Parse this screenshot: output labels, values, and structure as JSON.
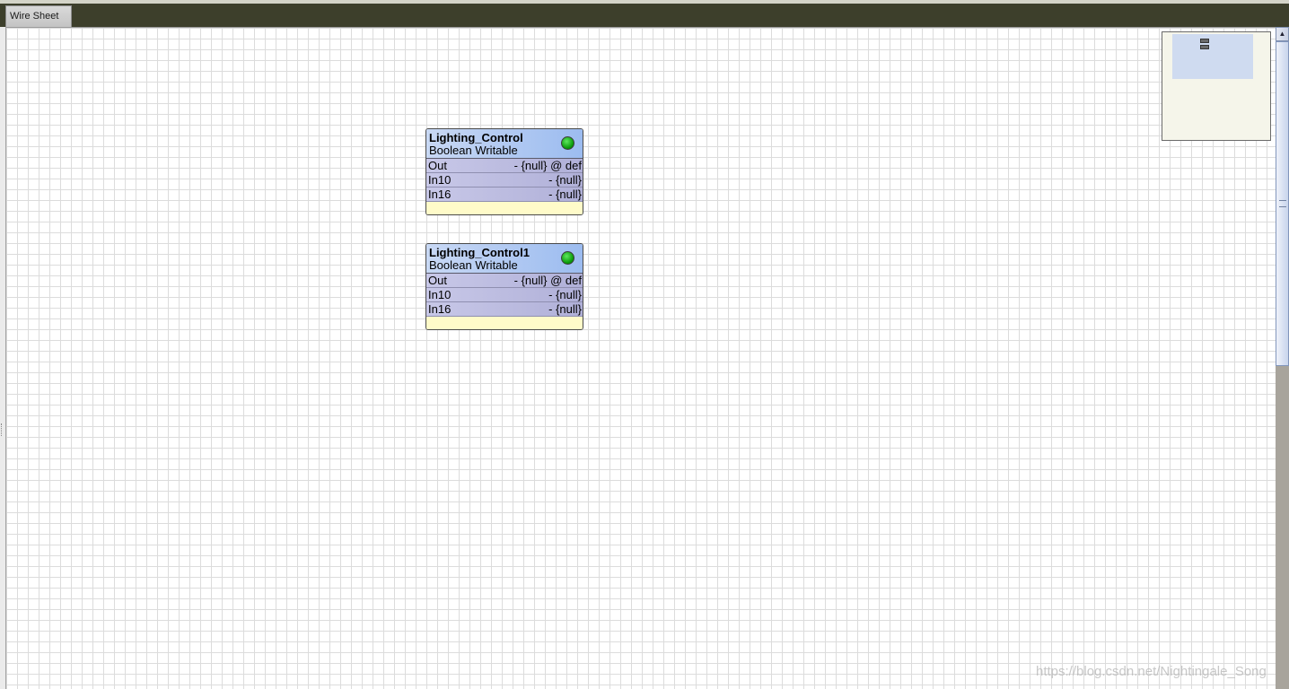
{
  "tabs": [
    {
      "label": "Wire Sheet"
    }
  ],
  "nodes": [
    {
      "title": "Lighting_Control",
      "type": "Boolean Writable",
      "status_color": "#16a016",
      "slots": [
        {
          "name": "Out",
          "value": "- {null} @ def"
        },
        {
          "name": "In10",
          "value": "- {null}"
        },
        {
          "name": "In16",
          "value": "- {null}"
        }
      ]
    },
    {
      "title": "Lighting_Control1",
      "type": "Boolean Writable",
      "status_color": "#16a016",
      "slots": [
        {
          "name": "Out",
          "value": "- {null} @ def"
        },
        {
          "name": "In10",
          "value": "- {null}"
        },
        {
          "name": "In16",
          "value": "- {null}"
        }
      ]
    }
  ],
  "scrollbar": {
    "up_icon": "up-arrow-icon"
  },
  "watermark": "https://blog.csdn.net/Nightingale_Song",
  "colors": {
    "tab_bar": "#3d3f2b",
    "node_header": "#9cbcf0",
    "slot_bg": "#b0b0d8",
    "node_footer": "#fffbc9",
    "minimap_bg": "#f5f5ea"
  }
}
